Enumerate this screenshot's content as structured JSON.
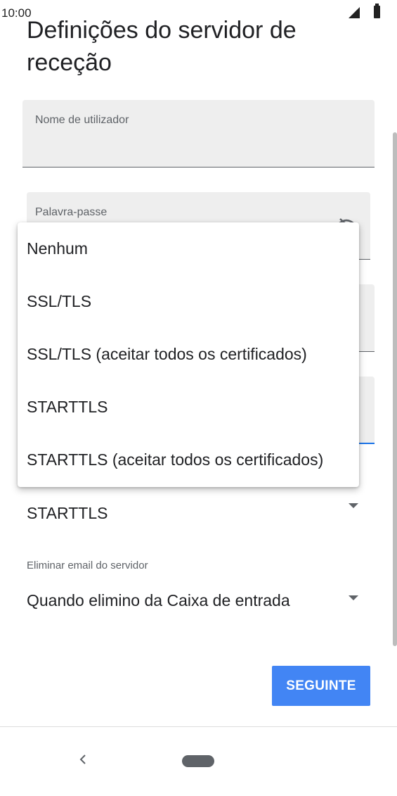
{
  "status_bar": {
    "time": "10:00"
  },
  "page": {
    "title": "Definições do servidor de receção"
  },
  "form": {
    "username": {
      "label": "Nome de utilizador"
    },
    "password": {
      "label": "Palavra-passe"
    }
  },
  "security_menu": {
    "options": [
      "Nenhum",
      "SSL/TLS",
      "SSL/TLS (aceitar todos os certificados)",
      "STARTTLS",
      "STARTTLS (aceitar todos os certificados)"
    ]
  },
  "security": {
    "selected": "STARTTLS"
  },
  "delete_email": {
    "label": "Eliminar email do servidor",
    "selected": "Quando elimino da Caixa de entrada"
  },
  "actions": {
    "next_label": "SEGUINTE"
  },
  "icons": {
    "signal": "signal-icon",
    "battery": "battery-icon",
    "visibility": "visibility-off-icon",
    "dropdown": "arrow-drop-down-icon",
    "back": "back-icon",
    "home": "home-icon"
  },
  "colors": {
    "accent": "#4285f4",
    "field_bg": "#eeeeee",
    "focus_line": "#1a73e8"
  }
}
